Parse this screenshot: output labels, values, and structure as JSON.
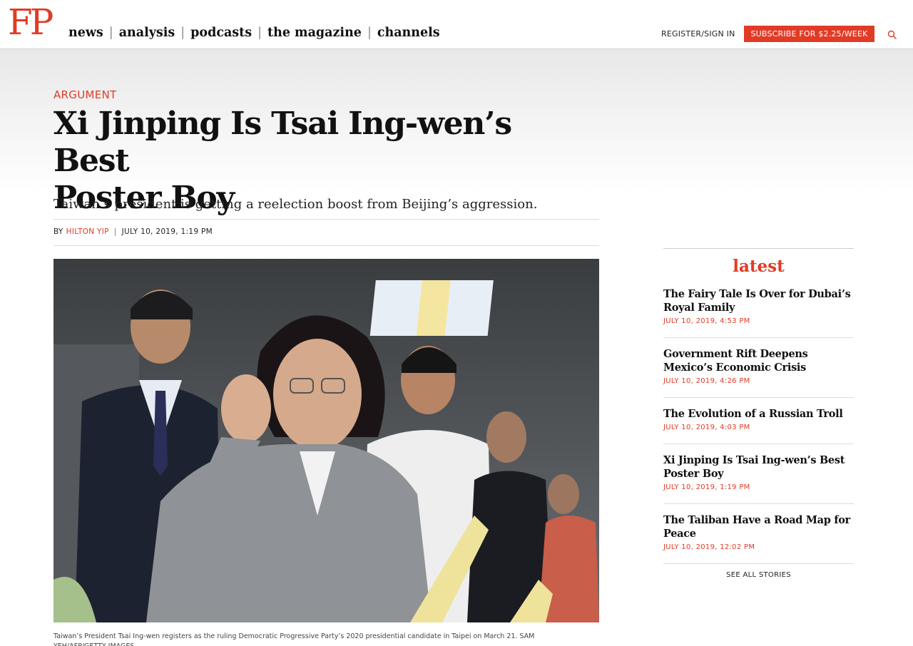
{
  "header": {
    "logo": "FP",
    "nav": [
      "news",
      "analysis",
      "podcasts",
      "the magazine",
      "channels"
    ],
    "register_label": "REGISTER/SIGN IN",
    "subscribe_label": "SUBSCRIBE FOR $2.25/WEEK",
    "search_icon": "search-icon",
    "accent_color": "#e13b26"
  },
  "article": {
    "kicker": "ARGUMENT",
    "headline_line1": "Xi Jinping Is Tsai Ing-wen’s Best",
    "headline_line2": "Poster Boy",
    "dek": "Taiwan’s president is getting a reelection boost from Beijing’s aggression.",
    "byline_prefix": "BY",
    "author": "HILTON YIP",
    "date": "JULY 10, 2019, 1:19 PM",
    "caption": "Taiwan’s President Tsai Ing-wen registers as the ruling Democratic Progressive Party’s 2020 presidential candidate in Taipei on March 21. SAM YEH/AFP/GETTY IMAGES"
  },
  "sidebar": {
    "title": "latest",
    "stories": [
      {
        "title": "The Fairy Tale Is Over for Dubai’s Royal Family",
        "date": "JULY 10, 2019, 4:53 PM"
      },
      {
        "title": "Government Rift Deepens Mexico’s Economic Crisis",
        "date": "JULY 10, 2019, 4:26 PM"
      },
      {
        "title": "The Evolution of a Russian Troll",
        "date": "JULY 10, 2019, 4:03 PM"
      },
      {
        "title": "Xi Jinping Is Tsai Ing-wen’s Best Poster Boy",
        "date": "JULY 10, 2019, 1:19 PM"
      },
      {
        "title": "The Taliban Have a Road Map for Peace",
        "date": "JULY 10, 2019, 12:02 PM"
      }
    ],
    "see_all_label": "SEE ALL STORIES"
  }
}
